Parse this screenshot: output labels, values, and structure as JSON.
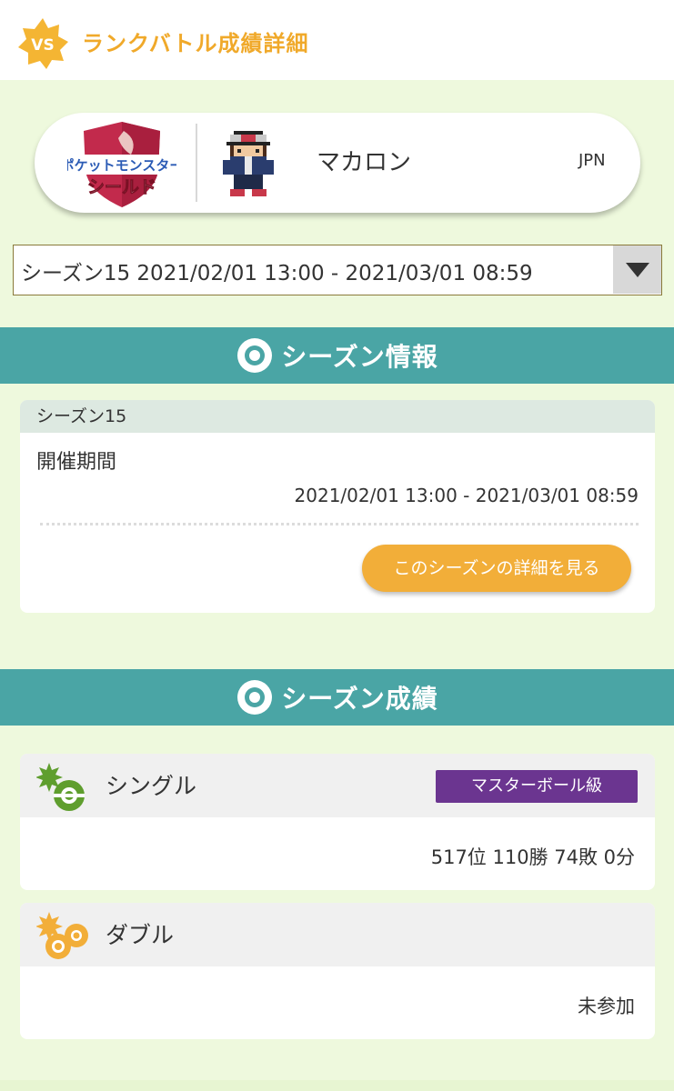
{
  "header": {
    "badge_text": "VS",
    "title": "ランクバトル成績詳細"
  },
  "trainer": {
    "game_logo_top": "ポケットモンスター",
    "game_logo_bottom": "シールド",
    "name": "マカロン",
    "country": "JPN"
  },
  "season_select": {
    "selected": "シーズン15 2021/02/01 13:00 - 2021/03/01 08:59"
  },
  "season_info": {
    "section_title": "シーズン情報",
    "season_name": "シーズン15",
    "period_label": "開催期間",
    "period_value": "2021/02/01 13:00 - 2021/03/01 08:59",
    "detail_button": "このシーズンの詳細を見る"
  },
  "season_results": {
    "section_title": "シーズン成績",
    "single": {
      "label": "シングル",
      "rank_badge": "マスターボール級",
      "stats": "517位 110勝 74敗 0分"
    },
    "double": {
      "label": "ダブル",
      "stats": "未参加"
    }
  },
  "colors": {
    "accent": "#f0a92a",
    "teal": "#4aa5a5",
    "background": "#eef9dd",
    "button": "#f2ae39",
    "rank_badge": "#6b3590",
    "single_icon": "#5f9e2e"
  }
}
